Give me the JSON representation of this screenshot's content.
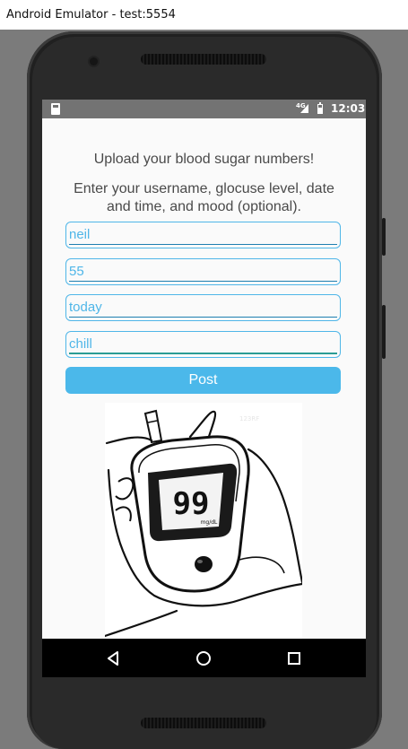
{
  "window": {
    "title": "Android Emulator - test:5554"
  },
  "status_bar": {
    "network_label": "4G",
    "time": "12:03"
  },
  "app": {
    "heading": "Upload your blood sugar numbers!",
    "instructions": "Enter your username, glocuse level, date and time, and mood (optional).",
    "fields": [
      {
        "name": "username",
        "value": "neil"
      },
      {
        "name": "glucose",
        "value": "55"
      },
      {
        "name": "datetime",
        "value": "today"
      },
      {
        "name": "mood",
        "value": "chill"
      }
    ],
    "post_label": "Post",
    "meter_reading": "99",
    "meter_unit": "mg/dL"
  },
  "nav": {
    "icons": [
      "back-icon",
      "home-icon",
      "recents-icon"
    ]
  },
  "colors": {
    "accent": "#4bb8ea",
    "field_text": "#4fb6e8",
    "status_bar": "#737373"
  }
}
